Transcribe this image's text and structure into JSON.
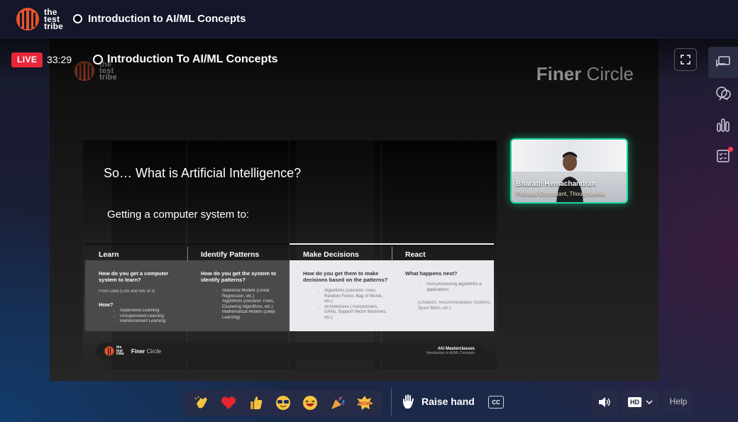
{
  "app": {
    "brand_lines": [
      "the",
      "test",
      "tribe"
    ],
    "title": "Introduction to AI/ML Concepts"
  },
  "player": {
    "live_label": "LIVE",
    "elapsed": "33:29",
    "stream_title": "Introduction To AI/ML Concepts",
    "stage_brand": {
      "bold": "Finer",
      "light": " Circle"
    }
  },
  "slide": {
    "title": "So… What is Artificial Intelligence?",
    "subtitle": "Getting a computer system to:",
    "columns": [
      {
        "header": "Learn",
        "question": "How do you get a computer system to learn?",
        "text": "From Data (Lots and lots of it)",
        "subhead": "How?",
        "bullets": [
          "Supervised Learning",
          "Unsupervised Learning",
          "Reinforcement Learning"
        ]
      },
      {
        "header": "Identify Patterns",
        "question": "How do you get the system to identify patterns?",
        "bullets": [
          "Statistical Models (Linear Regression, etc.)",
          "Algorithms (Decision Trees, Clustering Algorithms, etc.)",
          "Mathematical Models (Deep Learning)"
        ]
      },
      {
        "header": "Make Decisions",
        "question": "How do you get them to make decisions based on the patterns?",
        "bullets": [
          "Algorithms (Decision Trees, Random Forest, Bag of Words, etc.)",
          "Architectures (Transformers, GANs, Support Vector Machines, etc.)"
        ]
      },
      {
        "header": "React",
        "question": "What happens next?",
        "bullets": [
          "Post-processing algorithms & applications"
        ],
        "text": "(Chatbots, Recommendation Systems, Spam filters, etc.)"
      }
    ],
    "footer": {
      "brand_lines": [
        "the",
        "test",
        "tribe"
      ],
      "brand_bold": "Finer",
      "brand_light": " Circle",
      "right_title": "#AI Masterclasses",
      "right_sub": "Introduction to AI/ML Concepts"
    }
  },
  "speaker": {
    "name": "Bharath Hemachandran",
    "role": "Principal Consultant, Thoughtworks"
  },
  "controls": {
    "reactions": [
      "clap",
      "heart",
      "thumbs-up",
      "cool",
      "laugh",
      "party",
      "wow"
    ],
    "reaction_wow_label": "WOW",
    "raise_hand_label": "Raise hand",
    "cc_label": "CC",
    "quality_label": "HD",
    "help_label": "Help"
  },
  "colors": {
    "live": "#e8263a",
    "speaker_border": "#1fd6a0",
    "brand_orange": "#e8542a"
  }
}
